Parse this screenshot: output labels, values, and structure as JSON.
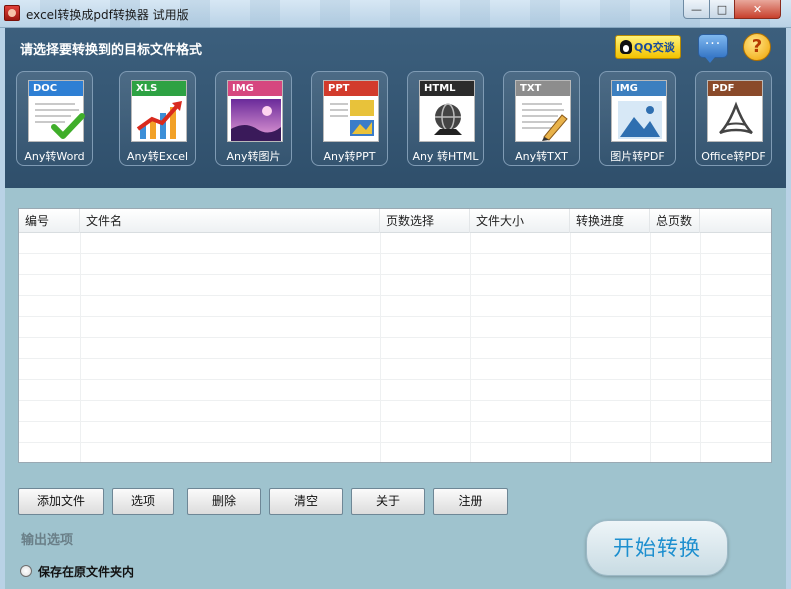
{
  "window": {
    "title": "excel转换成pdf转换器 试用版",
    "minimize_label": "—",
    "maximize_label": "□",
    "close_label": "✕"
  },
  "header": {
    "title": "请选择要转换到的目标文件格式",
    "qq_label": "QQ交谈",
    "chat_symbol": "···",
    "help_symbol": "?"
  },
  "formats": [
    {
      "badge": "DOC",
      "caption": "Any转Word",
      "color": "#2e7fd4",
      "icon": "word-document-icon"
    },
    {
      "badge": "XLS",
      "caption": "Any转Excel",
      "color": "#2ea243",
      "icon": "excel-document-icon"
    },
    {
      "badge": "IMG",
      "caption": "Any转图片",
      "color": "#d6477f",
      "icon": "image-document-icon"
    },
    {
      "badge": "PPT",
      "caption": "Any转PPT",
      "color": "#d23b2c",
      "icon": "ppt-document-icon"
    },
    {
      "badge": "HTML",
      "caption": "Any 转HTML",
      "color": "#2b2b2b",
      "icon": "html-document-icon"
    },
    {
      "badge": "TXT",
      "caption": "Any转TXT",
      "color": "#8d8d8d",
      "icon": "txt-document-icon"
    },
    {
      "badge": "IMG",
      "caption": "图片转PDF",
      "color": "#3c7fbf",
      "icon": "image-to-pdf-icon"
    },
    {
      "badge": "PDF",
      "caption": "Office转PDF",
      "color": "#8a4a2a",
      "icon": "pdf-document-icon"
    }
  ],
  "list": {
    "columns": [
      "编号",
      "文件名",
      "页数选择",
      "文件大小",
      "转换进度",
      "总页数"
    ],
    "rows": []
  },
  "toolbar": {
    "add": "添加文件",
    "options": "选项",
    "delete": "删除",
    "clear": "清空",
    "about": "关于",
    "register": "注册"
  },
  "output": {
    "section_label": "输出选项",
    "save_in_source_label": "保存在原文件夹内"
  },
  "start_label": "开始转换"
}
